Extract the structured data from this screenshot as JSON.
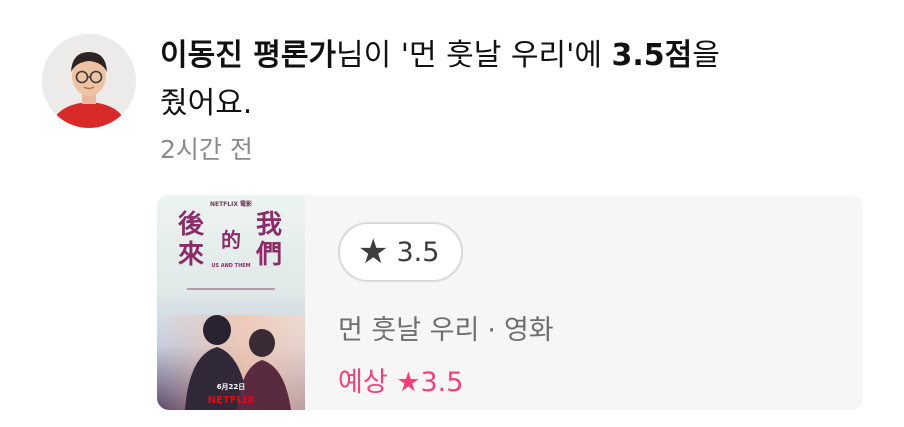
{
  "notification": {
    "reviewer_name": "이동진 평론가",
    "text_after_name": "님이 '먼 훗날 우리'에 ",
    "score": "3.5점",
    "text_after_score": "을",
    "text_line2": "줬어요.",
    "timestamp": "2시간 전"
  },
  "card": {
    "rating_chip": {
      "icon": "star-icon",
      "value": "3.5"
    },
    "movie_title": "먼 훗날 우리",
    "separator": "·",
    "category": "영화",
    "expected_label": "예상",
    "expected_star": "★",
    "expected_value": "3.5",
    "poster": {
      "brand_top": "NETFLIX 電影",
      "title_chars": [
        "後",
        "來",
        "的",
        "我",
        "們"
      ],
      "subtitle": "US AND THEM",
      "release_date": "6月22日",
      "brand_bottom": "NETFLIX"
    }
  },
  "colors": {
    "accent_pink": "#f0427c",
    "muted_gray": "#8a8a8a",
    "card_bg": "#f6f6f7"
  }
}
